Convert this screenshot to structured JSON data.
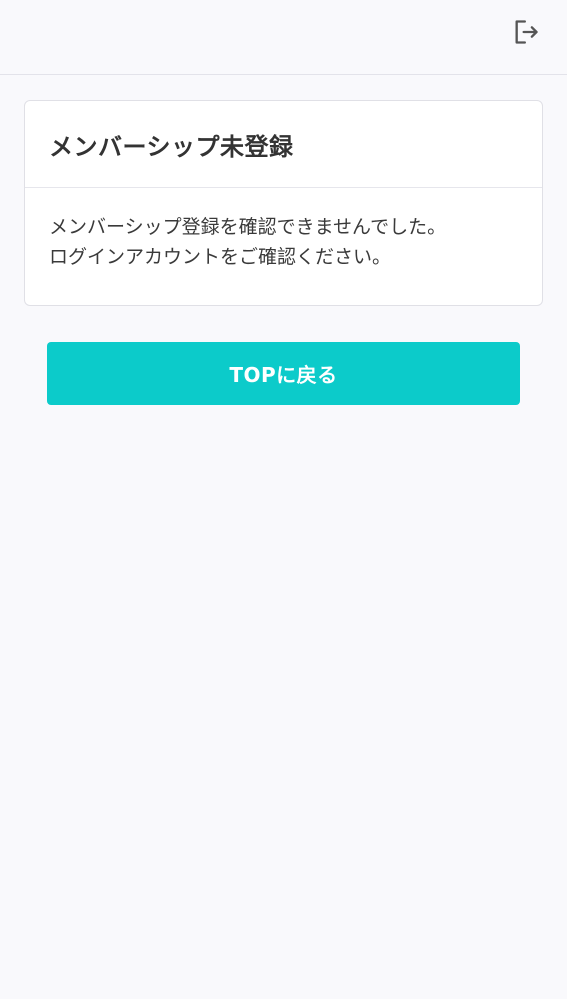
{
  "header": {
    "logout_icon": "logout-icon",
    "icon_color": "#555555"
  },
  "card": {
    "title": "メンバーシップ未登録",
    "body_lines": [
      "メンバーシップ登録を確認できませんでした。",
      "ログインアカウントをご確認ください。"
    ]
  },
  "actions": {
    "top_button_label": "TOPに戻る",
    "accent_color": "#0ccbca"
  }
}
